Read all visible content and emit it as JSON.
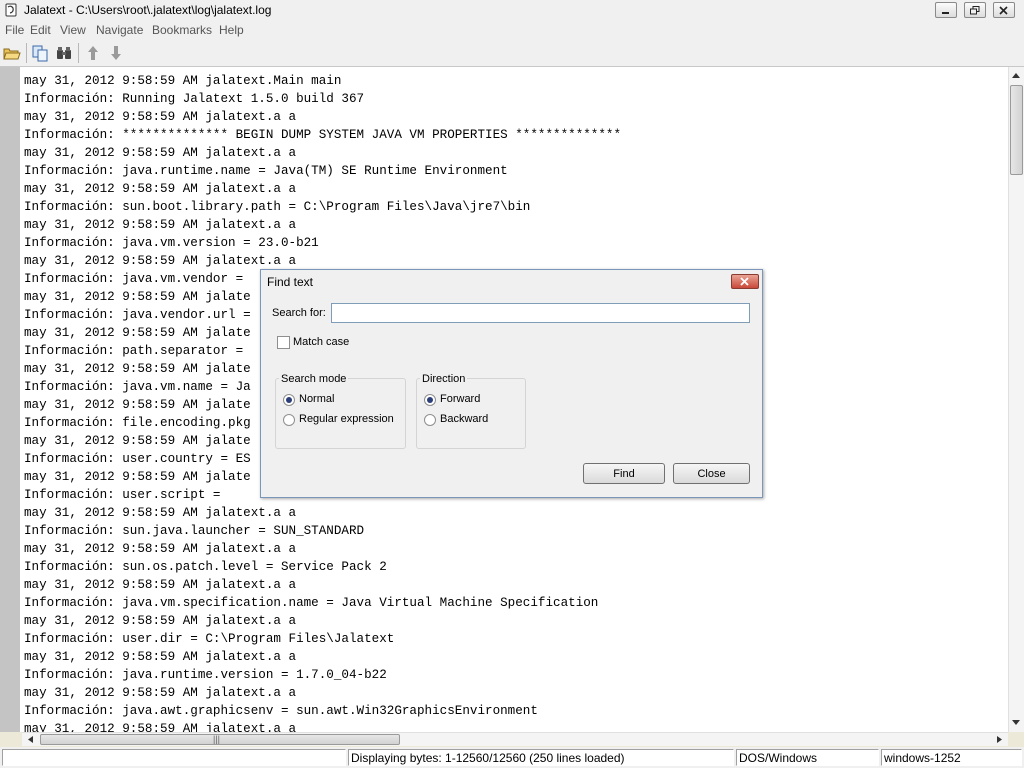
{
  "window": {
    "title": "Jalatext - C:\\Users\\root\\.jalatext\\log\\jalatext.log",
    "icon": "notepad-icon"
  },
  "menu": [
    {
      "label": "File"
    },
    {
      "label": "Edit"
    },
    {
      "label": "View"
    },
    {
      "label": "Navigate"
    },
    {
      "label": "Bookmarks"
    },
    {
      "label": "Help"
    }
  ],
  "toolbar": {
    "icons": [
      "open-folder-icon",
      "copy-icon",
      "binoculars-icon",
      "arrow-up-icon",
      "arrow-down-icon"
    ]
  },
  "editor": {
    "lines": [
      "may 31, 2012 9:58:59 AM jalatext.Main main",
      "Información: Running Jalatext 1.5.0 build 367",
      "may 31, 2012 9:58:59 AM jalatext.a a",
      "Información: ************** BEGIN DUMP SYSTEM JAVA VM PROPERTIES **************",
      "may 31, 2012 9:58:59 AM jalatext.a a",
      "Información: java.runtime.name = Java(TM) SE Runtime Environment",
      "may 31, 2012 9:58:59 AM jalatext.a a",
      "Información: sun.boot.library.path = C:\\Program Files\\Java\\jre7\\bin",
      "may 31, 2012 9:58:59 AM jalatext.a a",
      "Información: java.vm.version = 23.0-b21",
      "may 31, 2012 9:58:59 AM jalatext.a a",
      "Información: java.vm.vendor =",
      "may 31, 2012 9:58:59 AM jalate",
      "Información: java.vendor.url =",
      "may 31, 2012 9:58:59 AM jalate",
      "Información: path.separator =",
      "may 31, 2012 9:58:59 AM jalate",
      "Información: java.vm.name = Ja",
      "may 31, 2012 9:58:59 AM jalate",
      "Información: file.encoding.pkg",
      "may 31, 2012 9:58:59 AM jalate",
      "Información: user.country = ES",
      "may 31, 2012 9:58:59 AM jalate",
      "Información: user.script =",
      "may 31, 2012 9:58:59 AM jalatext.a a",
      "Información: sun.java.launcher = SUN_STANDARD",
      "may 31, 2012 9:58:59 AM jalatext.a a",
      "Información: sun.os.patch.level = Service Pack 2",
      "may 31, 2012 9:58:59 AM jalatext.a a",
      "Información: java.vm.specification.name = Java Virtual Machine Specification",
      "may 31, 2012 9:58:59 AM jalatext.a a",
      "Información: user.dir = C:\\Program Files\\Jalatext",
      "may 31, 2012 9:58:59 AM jalatext.a a",
      "Información: java.runtime.version = 1.7.0_04-b22",
      "may 31, 2012 9:58:59 AM jalatext.a a",
      "Información: java.awt.graphicsenv = sun.awt.Win32GraphicsEnvironment",
      "may 31, 2012 9:58:59 AM jalatext.a a"
    ]
  },
  "dialog": {
    "title": "Find text",
    "search_label": "Search for:",
    "search_value": "",
    "match_case_label": "Match case",
    "match_case_checked": false,
    "search_mode": {
      "title": "Search mode",
      "options": [
        "Normal",
        "Regular expression"
      ],
      "selected": "Normal"
    },
    "direction": {
      "title": "Direction",
      "options": [
        "Forward",
        "Backward"
      ],
      "selected": "Forward"
    },
    "find_button": "Find",
    "close_button": "Close"
  },
  "status": {
    "left": "",
    "bytes": "Displaying bytes: 1-12560/12560 (250 lines loaded)",
    "line_endings": "DOS/Windows",
    "encoding": "windows-1252"
  }
}
